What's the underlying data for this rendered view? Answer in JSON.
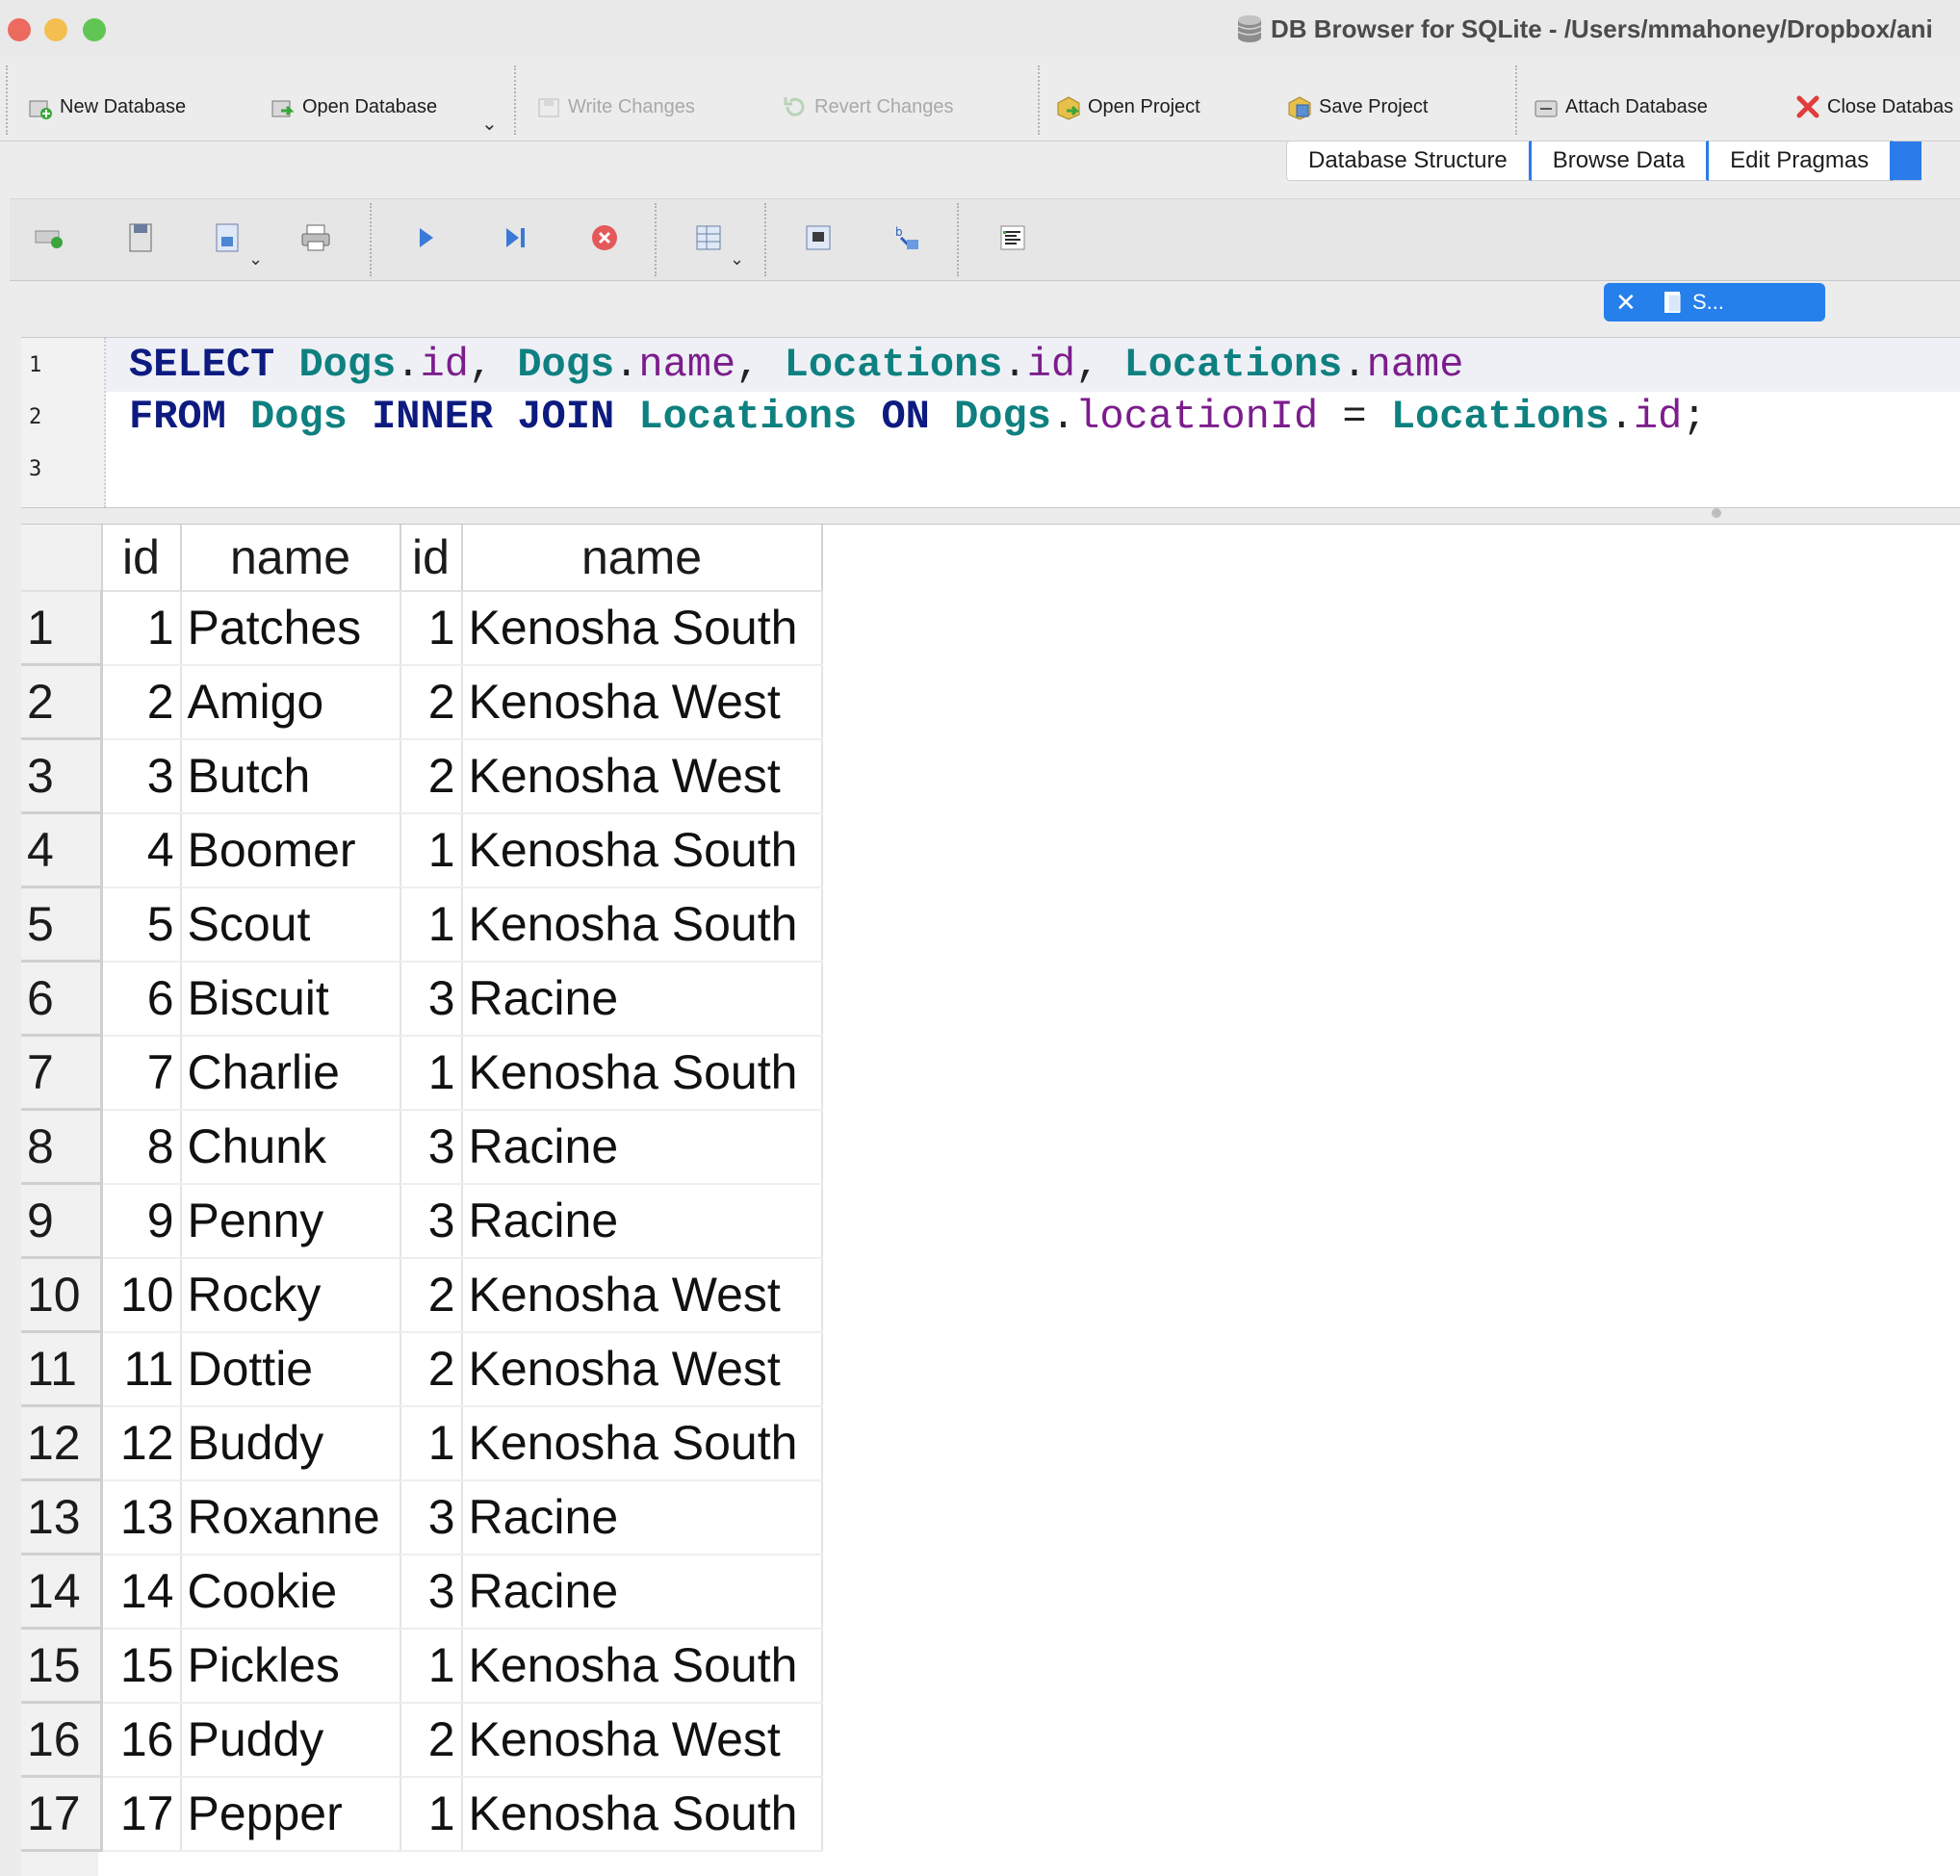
{
  "window": {
    "title": "DB Browser for SQLite - /Users/mmahoney/Dropbox/ani"
  },
  "toolbar": {
    "new_database": "New Database",
    "open_database": "Open Database",
    "write_changes": "Write Changes",
    "revert_changes": "Revert Changes",
    "open_project": "Open Project",
    "save_project": "Save Project",
    "attach_database": "Attach Database",
    "close_database": "Close Databas"
  },
  "tabs": [
    "Database Structure",
    "Browse Data",
    "Edit Pragmas"
  ],
  "docked_tab": {
    "label": "S..."
  },
  "editor": {
    "line_numbers": [
      "1",
      "2",
      "3"
    ],
    "line1": {
      "k1": "SELECT",
      "t1": "Dogs",
      "f1": "id",
      "t2": "Dogs",
      "f2": "name",
      "t3": "Locations",
      "f3": "id",
      "t4": "Locations",
      "f4": "name"
    },
    "line2": {
      "k1": "FROM",
      "t1": "Dogs",
      "k2": "INNER",
      "k3": "JOIN",
      "t2": "Locations",
      "k4": "ON",
      "t3": "Dogs",
      "f1": "locationId",
      "op": "=",
      "t4": "Locations",
      "f2": "id"
    }
  },
  "results": {
    "columns": [
      "id",
      "name",
      "id",
      "name"
    ],
    "rows": [
      [
        "1",
        "1",
        "Patches",
        "1",
        "Kenosha South"
      ],
      [
        "2",
        "2",
        "Amigo",
        "2",
        "Kenosha West"
      ],
      [
        "3",
        "3",
        "Butch",
        "2",
        "Kenosha West"
      ],
      [
        "4",
        "4",
        "Boomer",
        "1",
        "Kenosha South"
      ],
      [
        "5",
        "5",
        "Scout",
        "1",
        "Kenosha South"
      ],
      [
        "6",
        "6",
        "Biscuit",
        "3",
        "Racine"
      ],
      [
        "7",
        "7",
        "Charlie",
        "1",
        "Kenosha South"
      ],
      [
        "8",
        "8",
        "Chunk",
        "3",
        "Racine"
      ],
      [
        "9",
        "9",
        "Penny",
        "3",
        "Racine"
      ],
      [
        "10",
        "10",
        "Rocky",
        "2",
        "Kenosha West"
      ],
      [
        "11",
        "11",
        "Dottie",
        "2",
        "Kenosha West"
      ],
      [
        "12",
        "12",
        "Buddy",
        "1",
        "Kenosha South"
      ],
      [
        "13",
        "13",
        "Roxanne",
        "3",
        "Racine"
      ],
      [
        "14",
        "14",
        "Cookie",
        "3",
        "Racine"
      ],
      [
        "15",
        "15",
        "Pickles",
        "1",
        "Kenosha South"
      ],
      [
        "16",
        "16",
        "Puddy",
        "2",
        "Kenosha West"
      ],
      [
        "17",
        "17",
        "Pepper",
        "1",
        "Kenosha South"
      ]
    ]
  }
}
